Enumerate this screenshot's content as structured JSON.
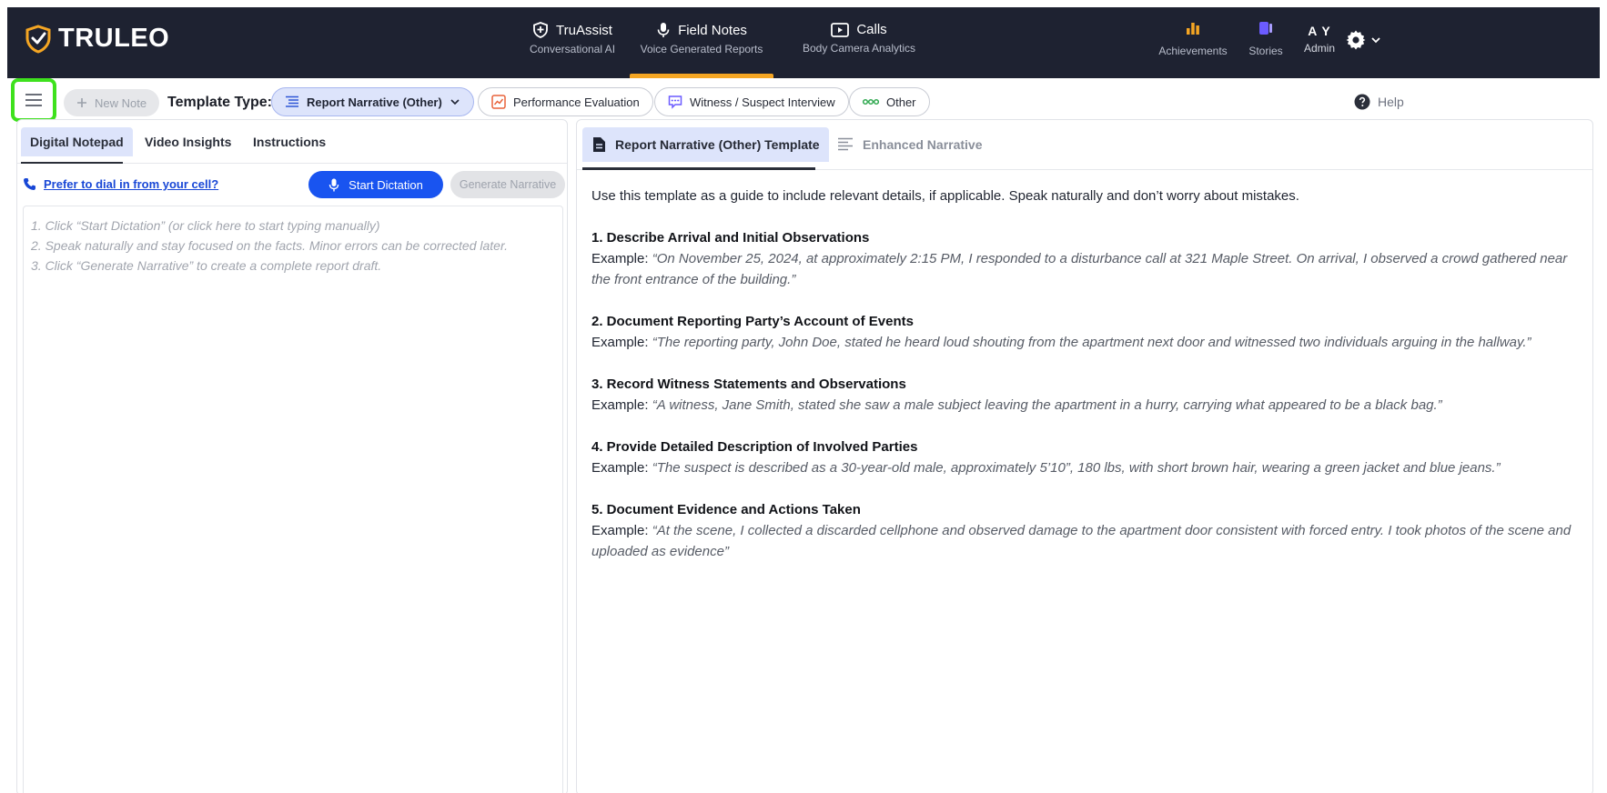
{
  "brand": {
    "name": "TRULEO",
    "accent": "#f5a623",
    "nav_bg": "#1e2231"
  },
  "nav": {
    "items": [
      {
        "title": "TruAssist",
        "subtitle": "Conversational AI",
        "icon": "shield-badge-icon"
      },
      {
        "title": "Field Notes",
        "subtitle": "Voice Generated Reports",
        "icon": "microphone-icon",
        "active": true
      },
      {
        "title": "Calls",
        "subtitle": "Body Camera Analytics",
        "icon": "video-play-icon"
      }
    ],
    "right": {
      "achievements_label": "Achievements",
      "stories_label": "Stories",
      "user_initials": "A Y",
      "user_role": "Admin"
    }
  },
  "toolbar": {
    "new_note_label": "New Note",
    "template_type_label": "Template Type:",
    "templates": [
      {
        "label": "Report Narrative (Other)",
        "active": true,
        "icon": "list-lines-icon"
      },
      {
        "label": "Performance Evaluation",
        "icon": "chart-trend-icon"
      },
      {
        "label": "Witness / Suspect Interview",
        "icon": "speech-bubble-icon"
      },
      {
        "label": "Other",
        "icon": "dots-icon"
      }
    ],
    "help_label": "Help"
  },
  "left": {
    "tabs": [
      {
        "label": "Digital Notepad",
        "active": true
      },
      {
        "label": "Video Insights"
      },
      {
        "label": "Instructions"
      }
    ],
    "dial_link": "Prefer to dial in from your cell?",
    "start_dictation": "Start Dictation",
    "generate_narrative": "Generate Narrative",
    "placeholder_lines": [
      "1. Click “Start Dictation” (or click here to start typing manually)",
      "2. Speak naturally and stay focused on the facts. Minor errors can be corrected later.",
      "3. Click “Generate Narrative” to create a complete report draft."
    ]
  },
  "right": {
    "tabs": [
      {
        "label": "Report Narrative (Other) Template",
        "active": true
      },
      {
        "label": "Enhanced Narrative"
      }
    ],
    "intro": "Use this template as a guide to include relevant details, if applicable. Speak naturally and don’t worry about mistakes.",
    "example_label": "Example:",
    "sections": [
      {
        "title": "1. Describe Arrival and Initial Observations",
        "example": "“On November 25, 2024, at approximately 2:15 PM, I responded to a disturbance call at 321 Maple Street. On arrival, I observed a crowd gathered near the front entrance of the building.”"
      },
      {
        "title": "2. Document Reporting Party’s Account of Events",
        "example": "“The reporting party, John Doe, stated he heard loud shouting from the apartment next door and witnessed two individuals arguing in the hallway.”"
      },
      {
        "title": "3. Record Witness Statements and Observations",
        "example": "“A witness, Jane Smith, stated she saw a male subject leaving the apartment in a hurry, carrying what appeared to be a black bag.”"
      },
      {
        "title": "4. Provide Detailed Description of Involved Parties",
        "example": "“The suspect is described as a 30-year-old male, approximately 5’10”, 180 lbs, with short brown hair, wearing a green jacket and blue jeans.”"
      },
      {
        "title": "5. Document Evidence and Actions Taken",
        "example": "“At the scene, I collected a discarded cellphone and observed damage to the apartment door consistent with forced entry. I took photos of the scene and uploaded as evidence”"
      }
    ]
  }
}
